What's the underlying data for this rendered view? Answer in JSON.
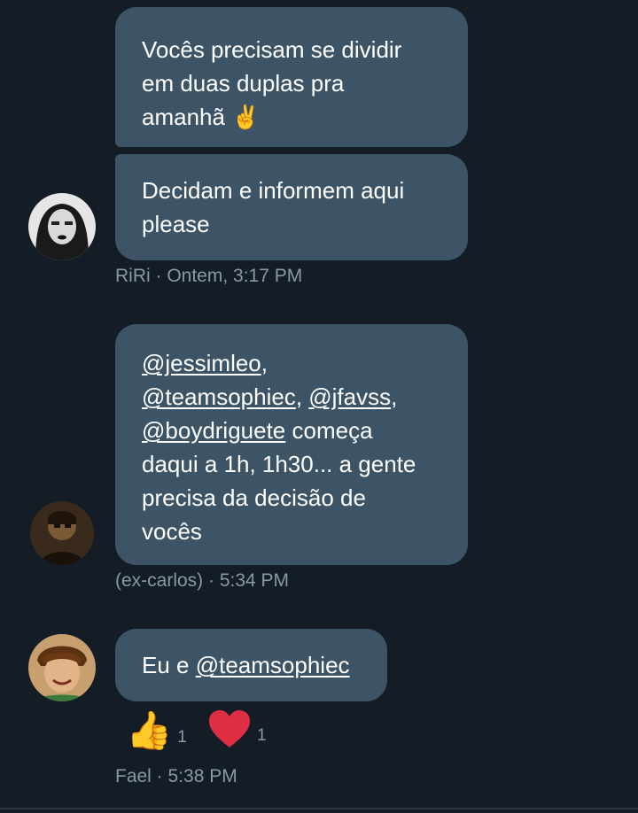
{
  "messages": [
    {
      "lines": [
        "Vocês precisam se dividir",
        "em duas duplas pra",
        "amanhã"
      ],
      "emoji": "✌️"
    },
    {
      "lines": [
        "Decidam e informem aqui",
        "please"
      ]
    },
    {
      "mentions": [
        "@jessimleo",
        "@teamsophiec",
        "@jfavss",
        "@boydriguete"
      ],
      "text_lines": [
        "começa",
        "daqui a 1h, 1h30... a gente",
        "precisa da decisão de",
        "vocês"
      ]
    },
    {
      "prefix": "Eu e",
      "mention": "@teamsophiec"
    }
  ],
  "meta": {
    "riri": "RiRi · Ontem, 3:17 PM",
    "excarlos": "(ex-carlos) · 5:34 PM",
    "fael": "Fael · 5:38 PM"
  },
  "reactions": [
    {
      "icon": "thumbs-up-icon",
      "glyph": "👍",
      "count": "1"
    },
    {
      "icon": "heart-icon",
      "glyph": "❤️",
      "count": "1"
    }
  ],
  "colors": {
    "background": "#141d26",
    "bubble": "#3d5466",
    "meta_text": "#8899a6"
  }
}
